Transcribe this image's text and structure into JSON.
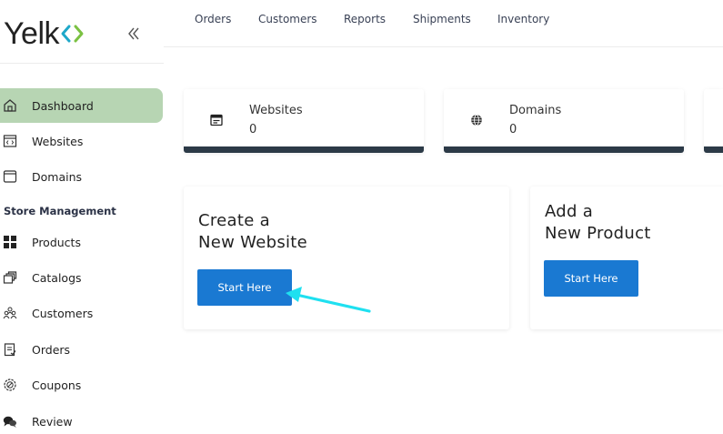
{
  "brand": {
    "name": "Yelk",
    "mark_color": "#1ea8c9",
    "mark_color_2": "#7bc142"
  },
  "sidebar": {
    "items": [
      {
        "label": "Dashboard",
        "icon": "home-icon",
        "active": true
      },
      {
        "label": "Websites",
        "icon": "code-window-icon"
      },
      {
        "label": "Domains",
        "icon": "browser-window-icon"
      }
    ],
    "section_label": "Store Management",
    "store_items": [
      {
        "label": "Products",
        "icon": "grid-icon"
      },
      {
        "label": "Catalogs",
        "icon": "stacked-cards-icon"
      },
      {
        "label": "Customers",
        "icon": "users-icon"
      },
      {
        "label": "Orders",
        "icon": "clipboard-icon"
      },
      {
        "label": "Coupons",
        "icon": "coupon-icon"
      },
      {
        "label": "Review",
        "icon": "chat-bubbles-icon"
      }
    ]
  },
  "topnav": {
    "items": [
      "Orders",
      "Customers",
      "Reports",
      "Shipments",
      "Inventory"
    ]
  },
  "stats": [
    {
      "title": "Websites",
      "value": "0",
      "icon": "website-icon"
    },
    {
      "title": "Domains",
      "value": "0",
      "icon": "globe-icon"
    }
  ],
  "actions": [
    {
      "line1": "Create a",
      "line2": "New Website",
      "button": "Start Here"
    },
    {
      "line1": "Add a",
      "line2": "New Product",
      "button": "Start Here"
    }
  ],
  "colors": {
    "active_bg": "#b7d5b3",
    "button_bg": "#1a79d2",
    "card_border": "#2c3a47",
    "arrow": "#1fe0f0"
  }
}
